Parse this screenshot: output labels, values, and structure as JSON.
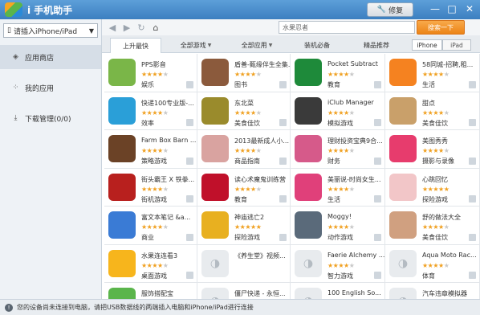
{
  "window": {
    "title": "i 手机助手",
    "update_label": "修复",
    "minimize": "—",
    "maximize": "□",
    "close": "✕"
  },
  "device_selector": {
    "value": "请插入iPhone/iPad"
  },
  "sidebar": {
    "items": [
      {
        "label": "应用商店",
        "icon": "store-icon"
      },
      {
        "label": "我的应用",
        "icon": "grid-icon"
      },
      {
        "label": "下载管理(0/0)",
        "icon": "download-icon"
      }
    ]
  },
  "toolbar": {
    "back": "◀",
    "forward": "▶",
    "refresh": "↻",
    "home": "⌂"
  },
  "search": {
    "value": "水果忍者",
    "button_label": "搜索一下"
  },
  "tabs": [
    {
      "label": "上升最快"
    },
    {
      "label": "全部游戏"
    },
    {
      "label": "全部应用"
    },
    {
      "label": "装机必备"
    },
    {
      "label": "精品推荐"
    }
  ],
  "device_toggle": {
    "iphone": "iPhone",
    "ipad": "iPad"
  },
  "apps": [
    {
      "name": "PPS影音",
      "category": "娱乐",
      "rating": 4,
      "color": "#7ab648"
    },
    {
      "name": "盾善-甄缘伴生全集...",
      "category": "图书",
      "rating": 4,
      "color": "#8b5a3c"
    },
    {
      "name": "Pocket Subtract",
      "category": "教育",
      "rating": 4,
      "color": "#1e8a3a"
    },
    {
      "name": "58同城-招聘,租...",
      "category": "生活",
      "rating": 4,
      "color": "#f58220"
    },
    {
      "name": "快递100专业版-...",
      "category": "效率",
      "rating": 4,
      "color": "#2a9fd8"
    },
    {
      "name": "东北菜",
      "category": "美食佳饮",
      "rating": 4,
      "color": "#9a8b2c"
    },
    {
      "name": "iClub Manager",
      "category": "模拟游戏",
      "rating": 4,
      "color": "#3a3a3a"
    },
    {
      "name": "甜点",
      "category": "美食佳饮",
      "rating": 4,
      "color": "#c9a06a"
    },
    {
      "name": "Farm Box Barn ...",
      "category": "策略游戏",
      "rating": 4,
      "color": "#6b4226"
    },
    {
      "name": "2013最新成人小...",
      "category": "商品指南",
      "rating": 4,
      "color": "#d9a3a0"
    },
    {
      "name": "理财投资宝典9合...",
      "category": "财务",
      "rating": 4,
      "color": "#d65a8a"
    },
    {
      "name": "美图秀秀",
      "category": "摄影与录像",
      "rating": 4,
      "color": "#e73c6d"
    },
    {
      "name": "街头霸王 X 铁拳...",
      "category": "街机游戏",
      "rating": 4,
      "color": "#b8201e"
    },
    {
      "name": "读心术魔鬼训练营",
      "category": "教育",
      "rating": 4,
      "color": "#c0102a"
    },
    {
      "name": "美丽说-时尚女生...",
      "category": "生活",
      "rating": 4,
      "color": "#e0407a"
    },
    {
      "name": "心跳回忆",
      "category": "探险游戏",
      "rating": 5,
      "color": "#f2c6c8"
    },
    {
      "name": "富文本笔记 &a...",
      "category": "商业",
      "rating": 4,
      "color": "#3a7bd5"
    },
    {
      "name": "神庙逃亡2",
      "category": "探险游戏",
      "rating": 5,
      "color": "#e8b020"
    },
    {
      "name": "Moggy!",
      "category": "动作游戏",
      "rating": 4,
      "color": "#5a6a7a"
    },
    {
      "name": "舒的做法大全",
      "category": "美食佳饮",
      "rating": 4,
      "color": "#d0a080"
    },
    {
      "name": "水果连连看3",
      "category": "桌面游戏",
      "rating": 4,
      "color": "#f7b51c"
    },
    {
      "name": "《养生堂》视频...",
      "category": "",
      "rating": 0,
      "color": ""
    },
    {
      "name": "Faerie Alchemy ...",
      "category": "智力游戏",
      "rating": 4,
      "color": ""
    },
    {
      "name": "Aqua Moto Rac...",
      "category": "体育",
      "rating": 4,
      "color": ""
    },
    {
      "name": "服饰搭配宝",
      "category": "",
      "rating": 0,
      "color": "#5ab54b"
    },
    {
      "name": "僵尸快递 - 永恒...",
      "category": "",
      "rating": 0,
      "color": ""
    },
    {
      "name": "100 English So...",
      "category": "",
      "rating": 0,
      "color": ""
    },
    {
      "name": "汽车违章模拟器",
      "category": "",
      "rating": 0,
      "color": ""
    }
  ],
  "status": {
    "message": "您的设备尚未连接到电脑，请把USB数据线的两端插入电脑和iPhone/iPad进行连接"
  }
}
